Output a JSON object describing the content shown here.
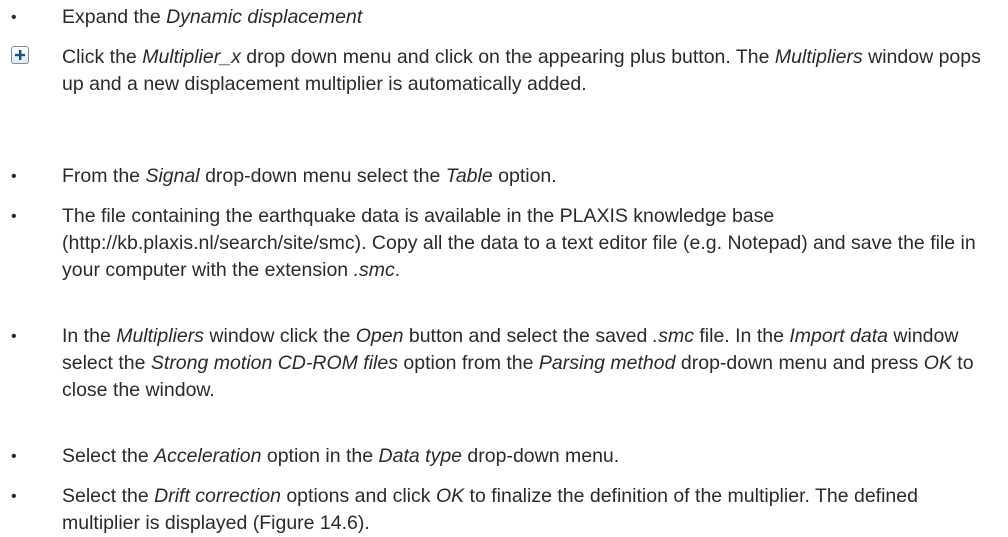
{
  "steps": [
    {
      "marker": "bullet",
      "parts": [
        {
          "t": "Expand the ",
          "i": false
        },
        {
          "t": "Dynamic displacement",
          "i": true
        }
      ]
    },
    {
      "marker": "plus-button",
      "parts": [
        {
          "t": "Click the ",
          "i": false
        },
        {
          "t": "Multiplier_x",
          "i": true
        },
        {
          "t": " drop down menu and click on the appearing plus button. The ",
          "i": false
        },
        {
          "t": "Multipliers",
          "i": true
        },
        {
          "t": " window pops up and a new displacement multiplier is automatically added.",
          "i": false
        }
      ]
    },
    {
      "marker": "bullet",
      "parts": [
        {
          "t": "From the ",
          "i": false
        },
        {
          "t": "Signal",
          "i": true
        },
        {
          "t": " drop-down menu select the ",
          "i": false
        },
        {
          "t": "Table",
          "i": true
        },
        {
          "t": " option.",
          "i": false
        }
      ]
    },
    {
      "marker": "bullet",
      "parts": [
        {
          "t": "The file containing the earthquake data is available in the PLAXIS knowledge base (http://kb.plaxis.nl/search/site/smc). Copy all the data to a text editor file (e.g. Notepad) and save the file in your computer with the extension ",
          "i": false
        },
        {
          "t": ".smc",
          "i": true
        },
        {
          "t": ".",
          "i": false
        }
      ]
    },
    {
      "marker": "bullet",
      "parts": [
        {
          "t": "In the ",
          "i": false
        },
        {
          "t": "Multipliers",
          "i": true
        },
        {
          "t": " window click the ",
          "i": false
        },
        {
          "t": "Open",
          "i": true
        },
        {
          "t": " button and select the saved ",
          "i": false
        },
        {
          "t": ".smc",
          "i": true
        },
        {
          "t": " file. In the ",
          "i": false
        },
        {
          "t": "Import data",
          "i": true
        },
        {
          "t": " window select the ",
          "i": false
        },
        {
          "t": "Strong motion CD-ROM files",
          "i": true
        },
        {
          "t": " option from the ",
          "i": false
        },
        {
          "t": "Parsing method",
          "i": true
        },
        {
          "t": " drop-down menu and press ",
          "i": false
        },
        {
          "t": "OK",
          "i": true
        },
        {
          "t": " to close the window.",
          "i": false
        }
      ]
    },
    {
      "marker": "bullet",
      "parts": [
        {
          "t": "Select the ",
          "i": false
        },
        {
          "t": "Acceleration",
          "i": true
        },
        {
          "t": " option in the ",
          "i": false
        },
        {
          "t": "Data type",
          "i": true
        },
        {
          "t": " drop-down menu.",
          "i": false
        }
      ]
    },
    {
      "marker": "bullet",
      "parts": [
        {
          "t": "Select the ",
          "i": false
        },
        {
          "t": "Drift correction",
          "i": true
        },
        {
          "t": " options and click ",
          "i": false
        },
        {
          "t": "OK",
          "i": true
        },
        {
          "t": " to finalize the definition of the multiplier. The defined multiplier is displayed (Figure 14.6).",
          "i": false
        }
      ]
    }
  ],
  "bullet_glyph": "•",
  "colors": {
    "text": "#2a2a2a",
    "plus_icon": "#1f4f8a",
    "button_border": "#7d8a99"
  }
}
